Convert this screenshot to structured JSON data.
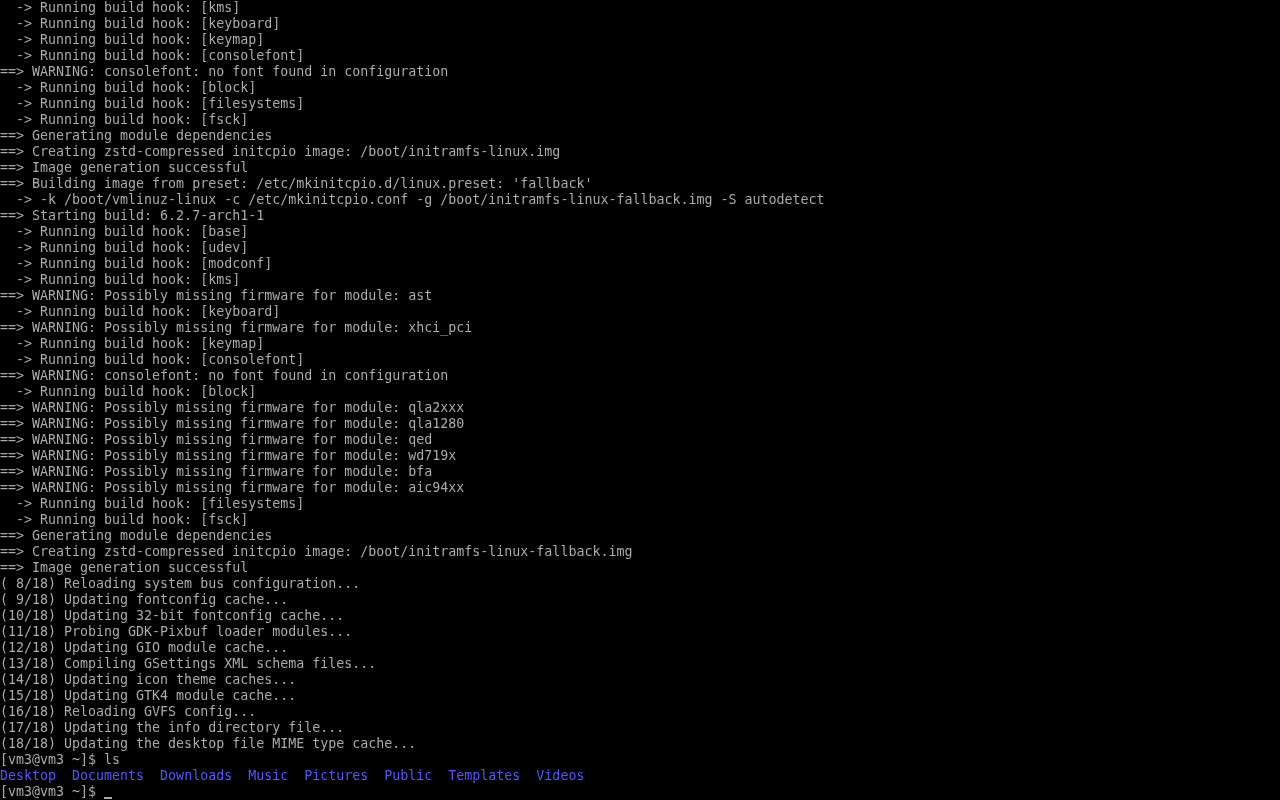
{
  "terminal": {
    "lines": [
      {
        "text": "  -> Running build hook: [kms]"
      },
      {
        "text": "  -> Running build hook: [keyboard]"
      },
      {
        "text": "  -> Running build hook: [keymap]"
      },
      {
        "text": "  -> Running build hook: [consolefont]"
      },
      {
        "text": "==> WARNING: consolefont: no font found in configuration"
      },
      {
        "text": "  -> Running build hook: [block]"
      },
      {
        "text": "  -> Running build hook: [filesystems]"
      },
      {
        "text": "  -> Running build hook: [fsck]"
      },
      {
        "text": "==> Generating module dependencies"
      },
      {
        "text": "==> Creating zstd-compressed initcpio image: /boot/initramfs-linux.img"
      },
      {
        "text": "==> Image generation successful"
      },
      {
        "text": "==> Building image from preset: /etc/mkinitcpio.d/linux.preset: 'fallback'"
      },
      {
        "text": "  -> -k /boot/vmlinuz-linux -c /etc/mkinitcpio.conf -g /boot/initramfs-linux-fallback.img -S autodetect"
      },
      {
        "text": "==> Starting build: 6.2.7-arch1-1"
      },
      {
        "text": "  -> Running build hook: [base]"
      },
      {
        "text": "  -> Running build hook: [udev]"
      },
      {
        "text": "  -> Running build hook: [modconf]"
      },
      {
        "text": "  -> Running build hook: [kms]"
      },
      {
        "text": "==> WARNING: Possibly missing firmware for module: ast"
      },
      {
        "text": "  -> Running build hook: [keyboard]"
      },
      {
        "text": "==> WARNING: Possibly missing firmware for module: xhci_pci"
      },
      {
        "text": "  -> Running build hook: [keymap]"
      },
      {
        "text": "  -> Running build hook: [consolefont]"
      },
      {
        "text": "==> WARNING: consolefont: no font found in configuration"
      },
      {
        "text": "  -> Running build hook: [block]"
      },
      {
        "text": "==> WARNING: Possibly missing firmware for module: qla2xxx"
      },
      {
        "text": "==> WARNING: Possibly missing firmware for module: qla1280"
      },
      {
        "text": "==> WARNING: Possibly missing firmware for module: qed"
      },
      {
        "text": "==> WARNING: Possibly missing firmware for module: wd719x"
      },
      {
        "text": "==> WARNING: Possibly missing firmware for module: bfa"
      },
      {
        "text": "==> WARNING: Possibly missing firmware for module: aic94xx"
      },
      {
        "text": "  -> Running build hook: [filesystems]"
      },
      {
        "text": "  -> Running build hook: [fsck]"
      },
      {
        "text": "==> Generating module dependencies"
      },
      {
        "text": "==> Creating zstd-compressed initcpio image: /boot/initramfs-linux-fallback.img"
      },
      {
        "text": "==> Image generation successful"
      },
      {
        "text": "( 8/18) Reloading system bus configuration..."
      },
      {
        "text": "( 9/18) Updating fontconfig cache..."
      },
      {
        "text": "(10/18) Updating 32-bit fontconfig cache..."
      },
      {
        "text": "(11/18) Probing GDK-Pixbuf loader modules..."
      },
      {
        "text": "(12/18) Updating GIO module cache..."
      },
      {
        "text": "(13/18) Compiling GSettings XML schema files..."
      },
      {
        "text": "(14/18) Updating icon theme caches..."
      },
      {
        "text": "(15/18) Updating GTK4 module cache..."
      },
      {
        "text": "(16/18) Reloading GVFS config..."
      },
      {
        "text": "(17/18) Updating the info directory file..."
      },
      {
        "text": "(18/18) Updating the desktop file MIME type cache..."
      },
      {
        "text": "[vm3@vm3 ~]$ ls"
      }
    ],
    "listing": [
      "Desktop",
      "Documents",
      "Downloads",
      "Music",
      "Pictures",
      "Public",
      "Templates",
      "Videos"
    ],
    "prompt": {
      "text": "[vm3@vm3 ~]$ ",
      "cursor": true
    }
  }
}
